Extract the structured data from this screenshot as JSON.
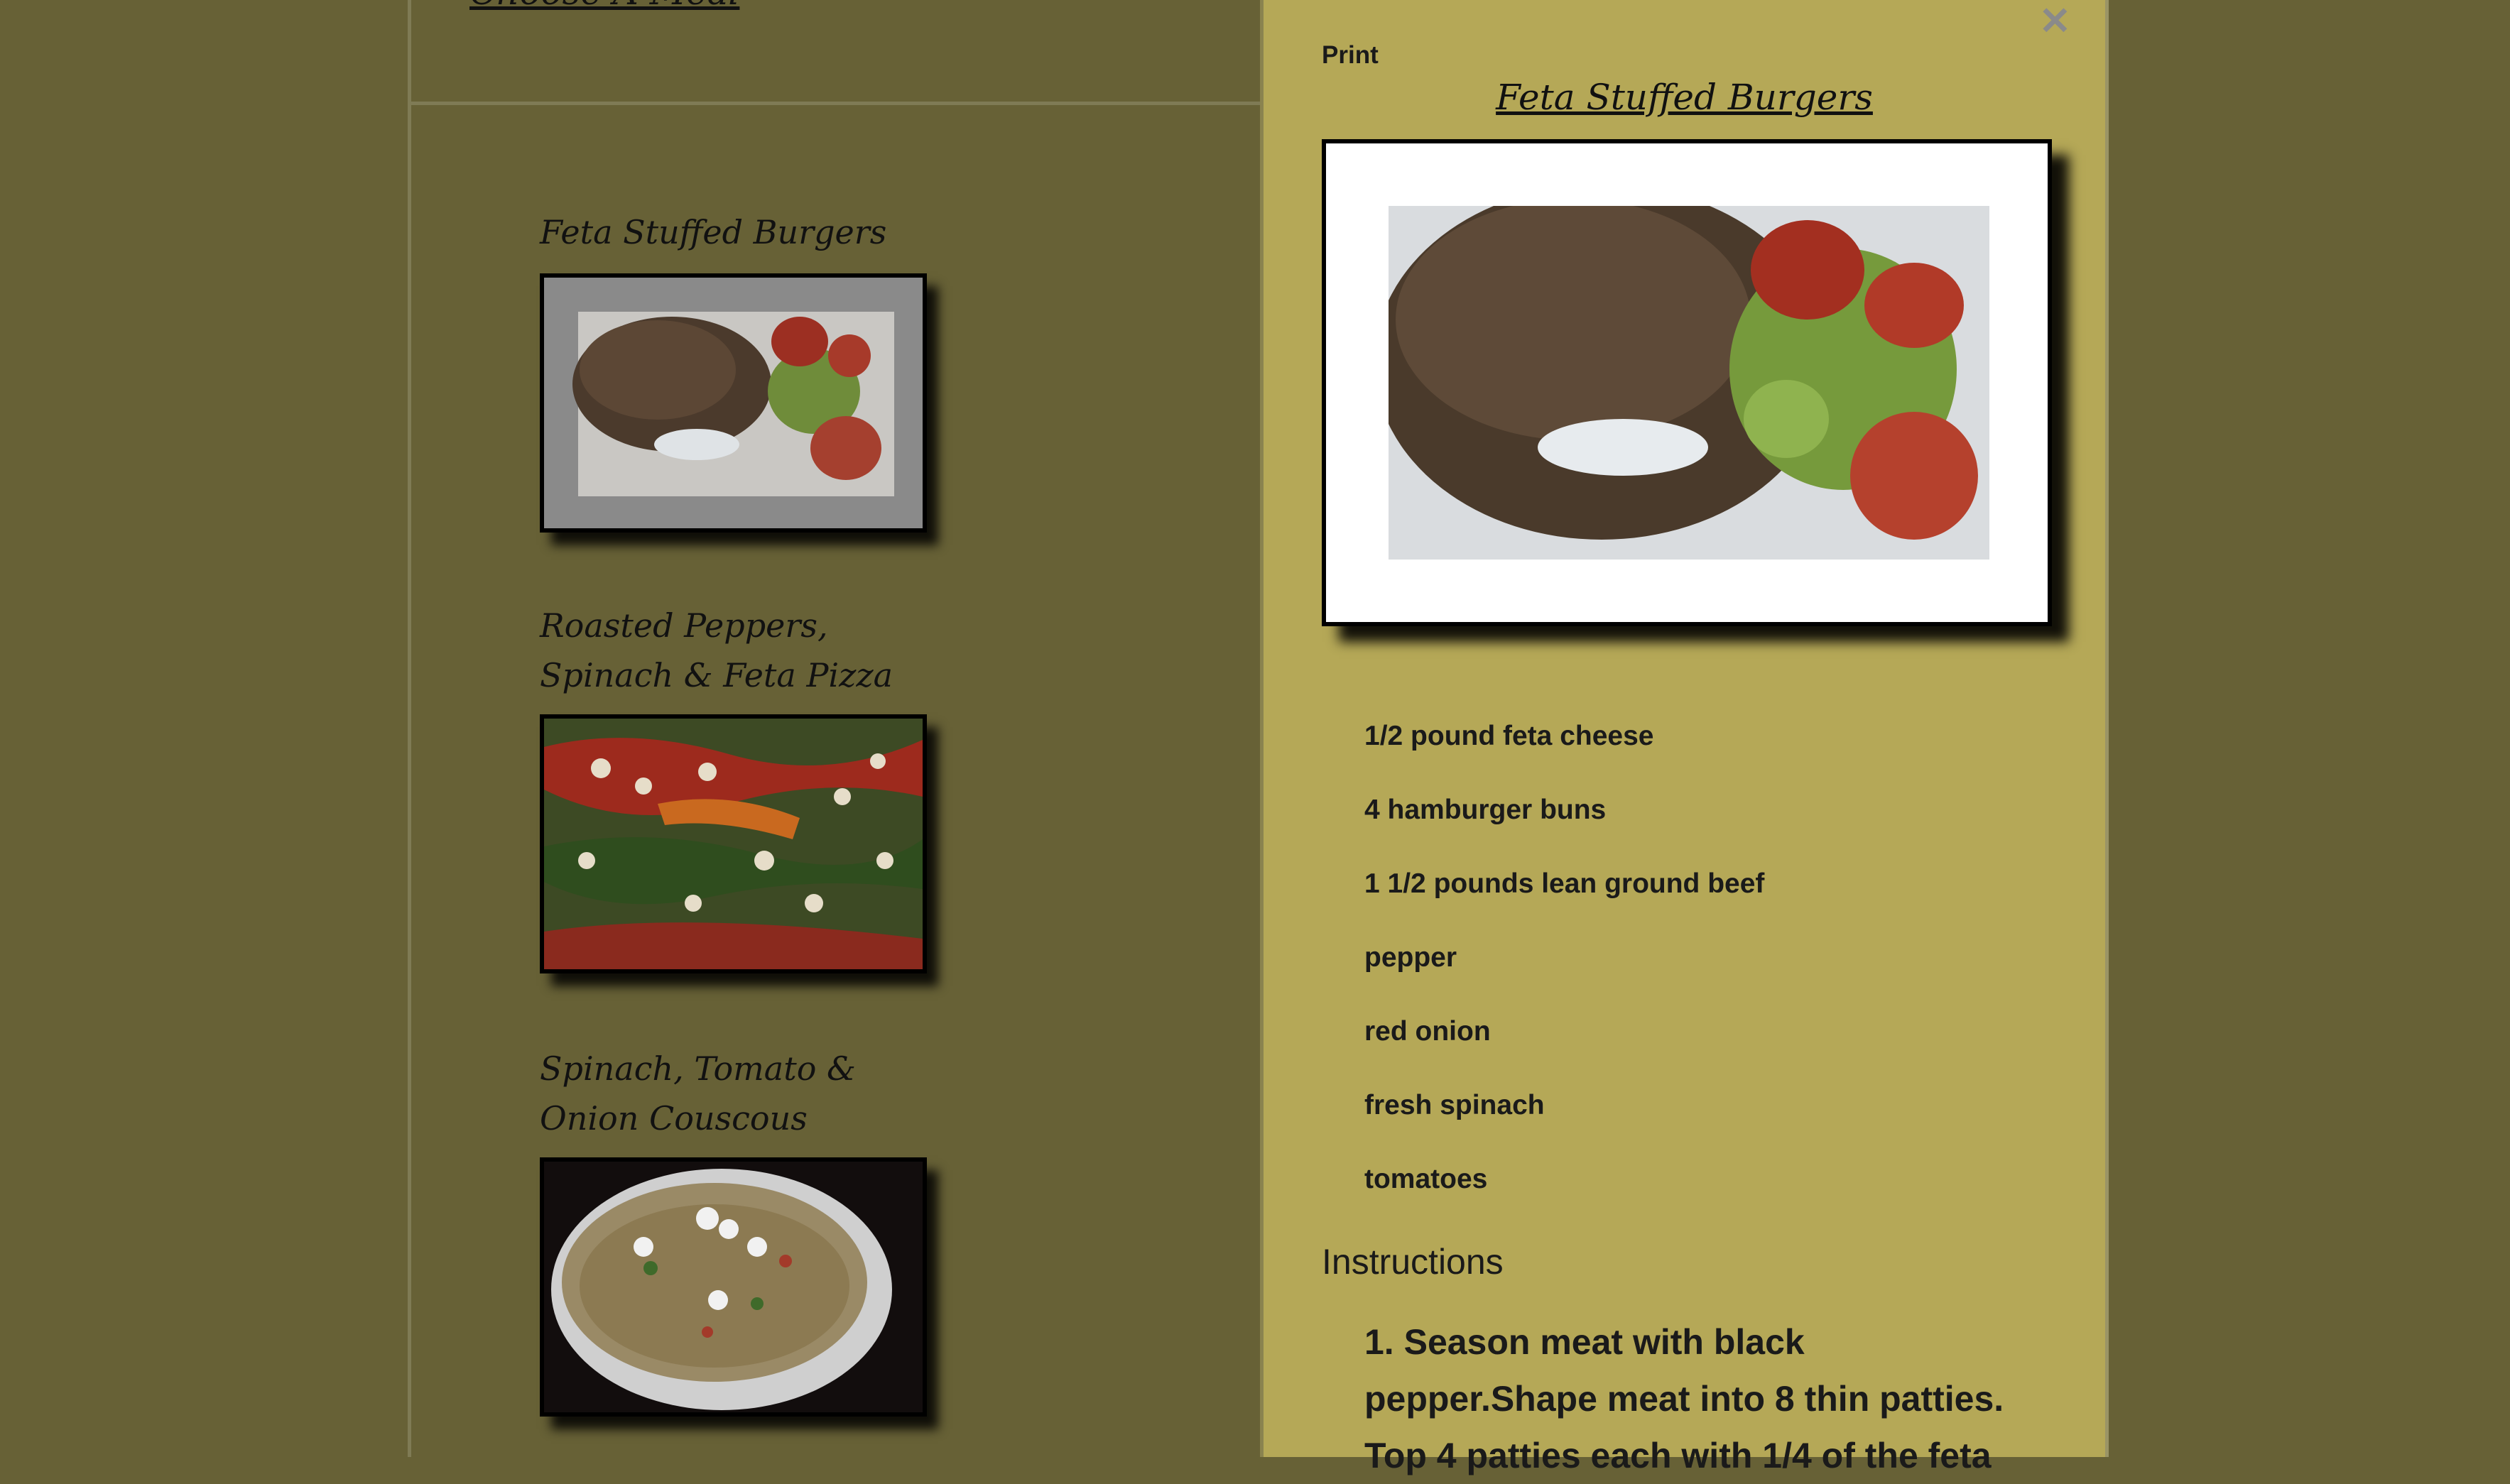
{
  "left_header": {
    "title": "Choose A Meal"
  },
  "recipes": [
    {
      "title": "Feta Stuffed Burgers"
    },
    {
      "title_line1": "Roasted Peppers,",
      "title_line2": "Spinach & Feta Pizza"
    },
    {
      "title_line1": "Spinach, Tomato &",
      "title_line2": "Onion Couscous"
    }
  ],
  "detail": {
    "close_label": "✕",
    "print_label": "Print",
    "title": "Feta Stuffed Burgers",
    "ingredients": [
      "1/2 pound feta cheese",
      "4 hamburger buns",
      "1 1/2 pounds lean ground beef",
      "pepper",
      "red onion",
      "fresh spinach",
      "tomatoes"
    ],
    "instructions_heading": "Instructions",
    "instructions_text": "1. Season meat with black pepper.Shape meat into 8 thin patties. Top 4 patties each with 1/4 of the feta"
  },
  "colors": {
    "page_background": "#676136",
    "detail_background": "#b5a857"
  }
}
